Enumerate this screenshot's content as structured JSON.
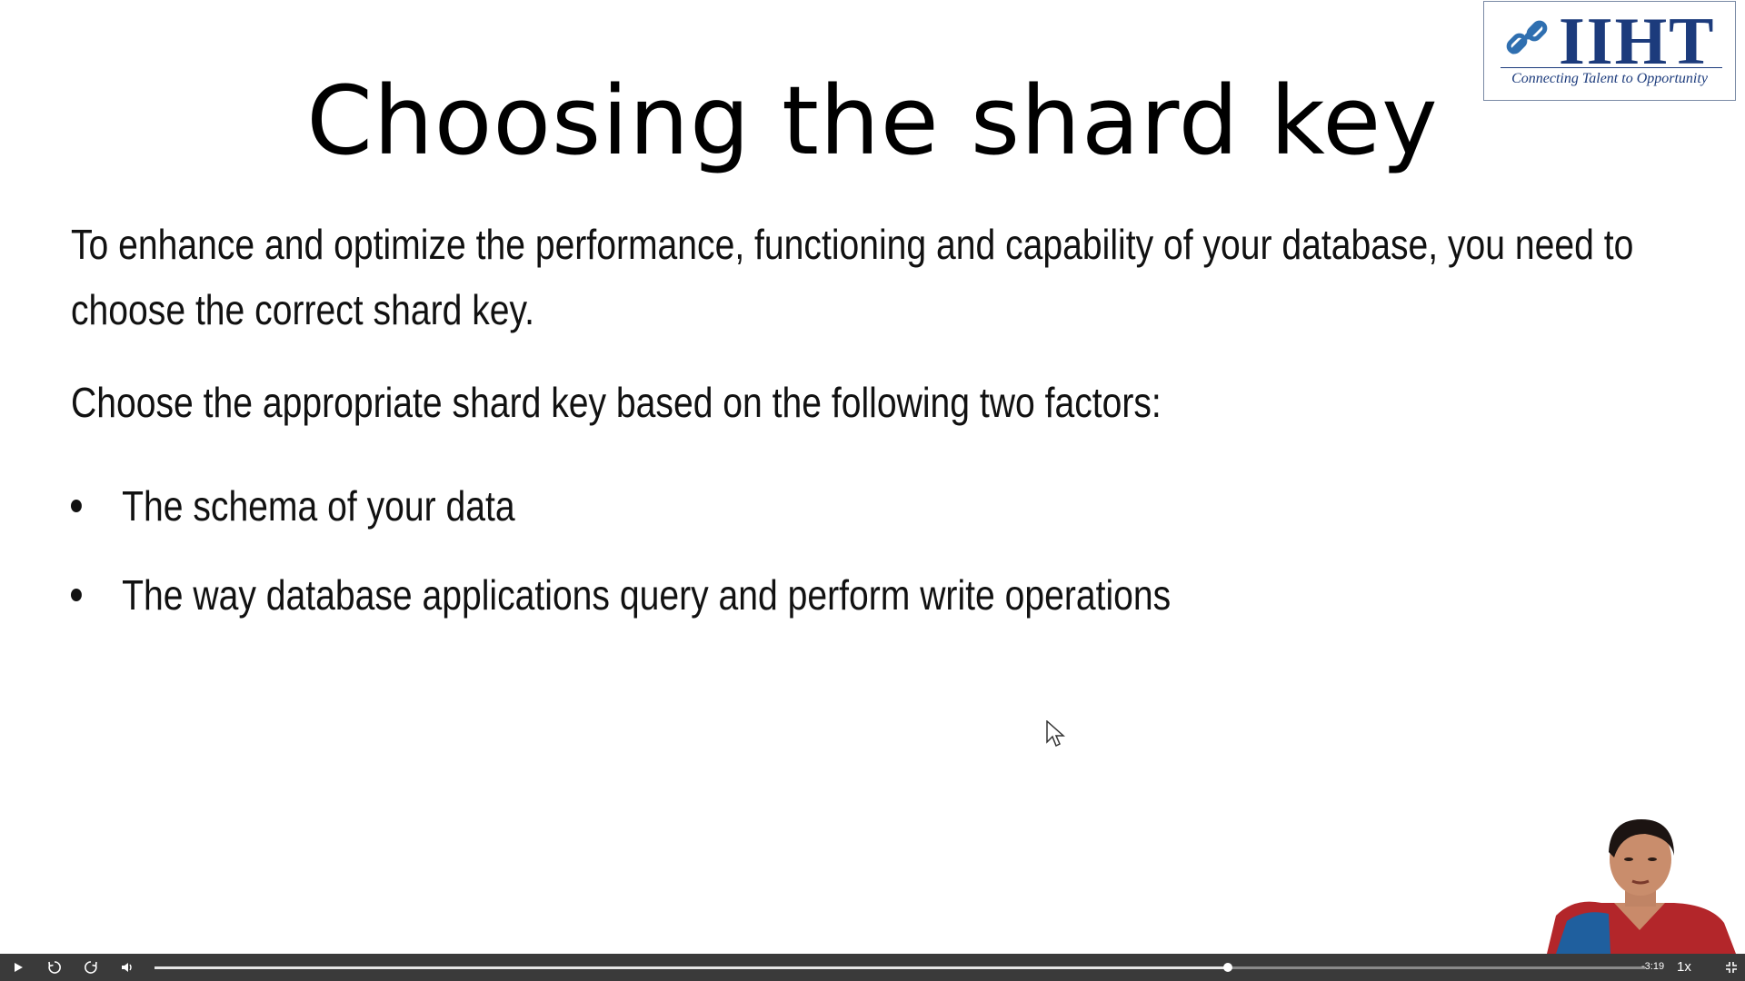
{
  "slide": {
    "title": "Choosing the shard key",
    "paragraph1_line1": "To enhance and optimize the performance, functioning and capability of your database, you need to",
    "paragraph1_line2": "choose the correct shard key.",
    "paragraph2": "Choose the appropriate shard key based on the following two factors:",
    "bullets": [
      "The schema of your data",
      "The way database applications query and perform write operations"
    ]
  },
  "logo": {
    "brand": "IIHT",
    "tagline": "Connecting Talent to Opportunity",
    "accent": "#1c3b7c"
  },
  "player": {
    "time_remaining": "-3:19",
    "speed": "1x",
    "progress_fraction": 0.72,
    "icons": [
      "play-icon",
      "rewind-10-icon",
      "forward-10-icon",
      "volume-icon",
      "exit-fullscreen-icon"
    ]
  }
}
